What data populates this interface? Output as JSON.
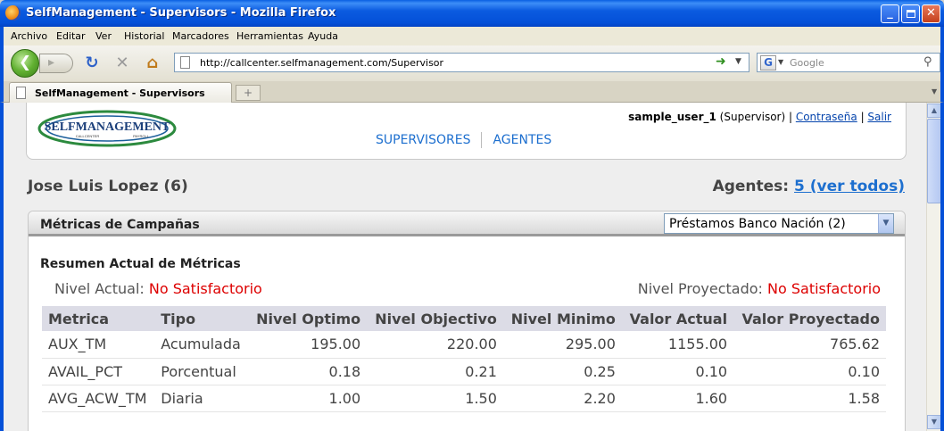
{
  "window": {
    "title": "SelfManagement - Supervisors - Mozilla Firefox"
  },
  "menu": [
    "Archivo",
    "Editar",
    "Ver",
    "Historial",
    "Marcadores",
    "Herramientas",
    "Ayuda"
  ],
  "toolbar": {
    "url": "http://callcenter.selfmanagement.com/Supervisor",
    "search_placeholder": "Google"
  },
  "tab": {
    "label": "SelfManagement - Supervisors"
  },
  "header": {
    "logo_text": "SELFMANAGEMENT",
    "logo_sub": "CALLCENTER",
    "logo_sub2": "PAYROLL",
    "user": "sample_user_1",
    "role": "(Supervisor)",
    "password_link": "Contraseña",
    "logout_link": "Salir",
    "nav": [
      "SUPERVISORES",
      "AGENTES"
    ]
  },
  "person": {
    "name": "Jose Luis Lopez (6)"
  },
  "agents": {
    "label": "Agentes:",
    "link": "5 (ver todos)"
  },
  "panel": {
    "title": "Métricas de Campañas",
    "campaign_selected": "Préstamos Banco Nación (2)",
    "subtitle": "Resumen Actual de Métricas",
    "current_label": "Nivel Actual:",
    "current_value": "No Satisfactorio",
    "projected_label": "Nivel Proyectado:",
    "projected_value": "No Satisfactorio"
  },
  "table": {
    "headers": [
      "Metrica",
      "Tipo",
      "Nivel Optimo",
      "Nivel Objectivo",
      "Nivel Minimo",
      "Valor Actual",
      "Valor Proyectado"
    ],
    "rows": [
      [
        "AUX_TM",
        "Acumulada",
        "195.00",
        "220.00",
        "295.00",
        "1155.00",
        "765.62"
      ],
      [
        "AVAIL_PCT",
        "Porcentual",
        "0.18",
        "0.21",
        "0.25",
        "0.10",
        "0.10"
      ],
      [
        "AVG_ACW_TM",
        "Diaria",
        "1.00",
        "1.50",
        "2.20",
        "1.60",
        "1.58"
      ]
    ]
  },
  "icons": [
    "firefox-icon",
    "back-icon",
    "forward-icon",
    "reload-icon",
    "stop-icon",
    "home-icon",
    "go-icon",
    "google-icon",
    "search-icon",
    "new-tab-icon"
  ]
}
